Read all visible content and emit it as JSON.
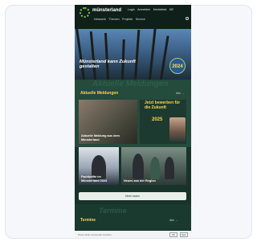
{
  "nav": {
    "brand": "münsterland",
    "top_links": [
      "Login",
      "Anmelden",
      "Mediathek",
      "DE"
    ],
    "main_links": [
      "Netzwerk",
      "Themen",
      "Projekte",
      "Service"
    ]
  },
  "hero": {
    "title": "Münsterland kann Zukunft gestalten",
    "badge": "2024"
  },
  "news": {
    "ghost_heading": "Aktuelle Meldungen",
    "section_label": "Aktuelle Meldungen",
    "section_link": "Alle →",
    "tiles": [
      {
        "caption": "Aktuelle Meldung aus dem Münsterland"
      },
      {
        "caption": "Fachkräfte im Münsterland 2024"
      },
      {
        "caption": "Neues aus der Region"
      }
    ],
    "promo": {
      "title": "Jetzt bewerben für die Zukunft",
      "subtitle": "2025"
    }
  },
  "cta_label": "Mehr laden",
  "termine": {
    "ghost_heading": "Termine",
    "label": "Termine",
    "link": "Alle →"
  },
  "cookie": {
    "text": "Diese Seite verwendet Cookies.",
    "accept": "OK",
    "decline": "Nein"
  }
}
